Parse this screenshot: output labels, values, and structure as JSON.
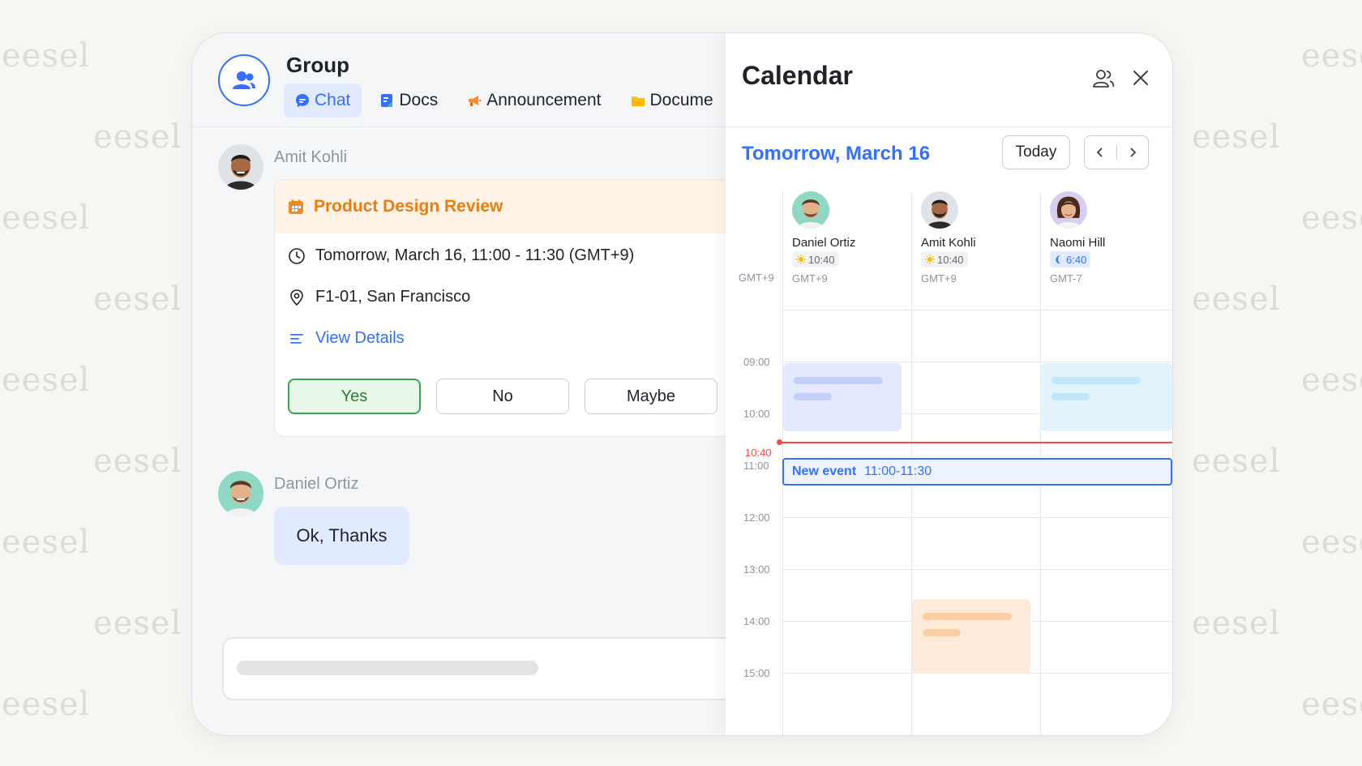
{
  "watermark": "eesel",
  "group": {
    "title": "Group",
    "tabs": [
      {
        "label": "Chat",
        "icon": "chat-bubble-icon",
        "active": true
      },
      {
        "label": "Docs",
        "icon": "docs-icon",
        "active": false
      },
      {
        "label": "Announcement",
        "icon": "megaphone-icon",
        "active": false
      },
      {
        "label": "Docume",
        "icon": "folder-icon",
        "active": false
      }
    ]
  },
  "messages": [
    {
      "sender": "Amit Kohli",
      "event": {
        "title": "Product Design Review",
        "time": "Tomorrow, March 16, 11:00 - 11:30 (GMT+9)",
        "location": "F1-01, San Francisco",
        "details_link": "View Details",
        "rsvp": {
          "yes": "Yes",
          "no": "No",
          "maybe": "Maybe",
          "selected": "yes"
        }
      }
    },
    {
      "sender": "Daniel Ortiz",
      "text": "Ok, Thanks"
    }
  ],
  "calendar": {
    "title": "Calendar",
    "date_label": "Tomorrow, March 16",
    "today_button": "Today",
    "timezone_column": "GMT+9",
    "people": [
      {
        "name": "Daniel Ortiz",
        "local_time": "10:40",
        "time_icon": "sun-icon",
        "timezone": "GMT+9"
      },
      {
        "name": "Amit Kohli",
        "local_time": "10:40",
        "time_icon": "sun-icon",
        "timezone": "GMT+9"
      },
      {
        "name": "Naomi Hill",
        "local_time": "6:40",
        "time_icon": "moon-icon",
        "timezone": "GMT-7"
      }
    ],
    "hours": [
      "09:00",
      "10:00",
      "11:00",
      "12:00",
      "13:00",
      "14:00",
      "15:00"
    ],
    "current_time": "10:40",
    "new_event": {
      "title": "New event",
      "time": "11:00-11:30"
    },
    "colors": {
      "accent": "#3370ff",
      "now_line": "#f54a45",
      "event_orange": "#e87e12"
    }
  }
}
